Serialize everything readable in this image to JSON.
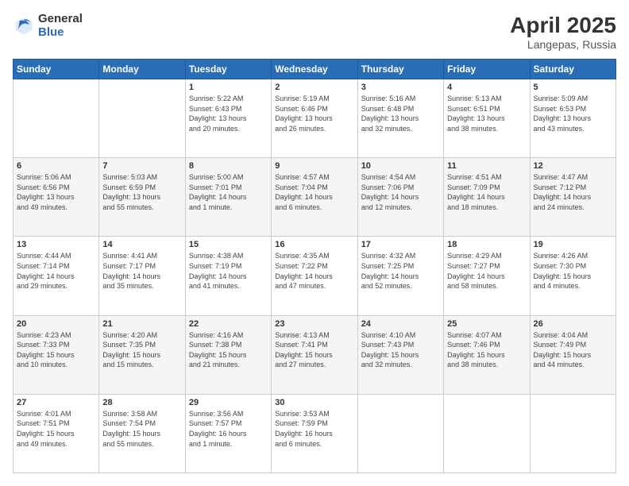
{
  "header": {
    "logo_general": "General",
    "logo_blue": "Blue",
    "title": "April 2025",
    "location": "Langepas, Russia"
  },
  "weekdays": [
    "Sunday",
    "Monday",
    "Tuesday",
    "Wednesday",
    "Thursday",
    "Friday",
    "Saturday"
  ],
  "weeks": [
    [
      {
        "day": "",
        "info": ""
      },
      {
        "day": "",
        "info": ""
      },
      {
        "day": "1",
        "info": "Sunrise: 5:22 AM\nSunset: 6:43 PM\nDaylight: 13 hours\nand 20 minutes."
      },
      {
        "day": "2",
        "info": "Sunrise: 5:19 AM\nSunset: 6:46 PM\nDaylight: 13 hours\nand 26 minutes."
      },
      {
        "day": "3",
        "info": "Sunrise: 5:16 AM\nSunset: 6:48 PM\nDaylight: 13 hours\nand 32 minutes."
      },
      {
        "day": "4",
        "info": "Sunrise: 5:13 AM\nSunset: 6:51 PM\nDaylight: 13 hours\nand 38 minutes."
      },
      {
        "day": "5",
        "info": "Sunrise: 5:09 AM\nSunset: 6:53 PM\nDaylight: 13 hours\nand 43 minutes."
      }
    ],
    [
      {
        "day": "6",
        "info": "Sunrise: 5:06 AM\nSunset: 6:56 PM\nDaylight: 13 hours\nand 49 minutes."
      },
      {
        "day": "7",
        "info": "Sunrise: 5:03 AM\nSunset: 6:59 PM\nDaylight: 13 hours\nand 55 minutes."
      },
      {
        "day": "8",
        "info": "Sunrise: 5:00 AM\nSunset: 7:01 PM\nDaylight: 14 hours\nand 1 minute."
      },
      {
        "day": "9",
        "info": "Sunrise: 4:57 AM\nSunset: 7:04 PM\nDaylight: 14 hours\nand 6 minutes."
      },
      {
        "day": "10",
        "info": "Sunrise: 4:54 AM\nSunset: 7:06 PM\nDaylight: 14 hours\nand 12 minutes."
      },
      {
        "day": "11",
        "info": "Sunrise: 4:51 AM\nSunset: 7:09 PM\nDaylight: 14 hours\nand 18 minutes."
      },
      {
        "day": "12",
        "info": "Sunrise: 4:47 AM\nSunset: 7:12 PM\nDaylight: 14 hours\nand 24 minutes."
      }
    ],
    [
      {
        "day": "13",
        "info": "Sunrise: 4:44 AM\nSunset: 7:14 PM\nDaylight: 14 hours\nand 29 minutes."
      },
      {
        "day": "14",
        "info": "Sunrise: 4:41 AM\nSunset: 7:17 PM\nDaylight: 14 hours\nand 35 minutes."
      },
      {
        "day": "15",
        "info": "Sunrise: 4:38 AM\nSunset: 7:19 PM\nDaylight: 14 hours\nand 41 minutes."
      },
      {
        "day": "16",
        "info": "Sunrise: 4:35 AM\nSunset: 7:22 PM\nDaylight: 14 hours\nand 47 minutes."
      },
      {
        "day": "17",
        "info": "Sunrise: 4:32 AM\nSunset: 7:25 PM\nDaylight: 14 hours\nand 52 minutes."
      },
      {
        "day": "18",
        "info": "Sunrise: 4:29 AM\nSunset: 7:27 PM\nDaylight: 14 hours\nand 58 minutes."
      },
      {
        "day": "19",
        "info": "Sunrise: 4:26 AM\nSunset: 7:30 PM\nDaylight: 15 hours\nand 4 minutes."
      }
    ],
    [
      {
        "day": "20",
        "info": "Sunrise: 4:23 AM\nSunset: 7:33 PM\nDaylight: 15 hours\nand 10 minutes."
      },
      {
        "day": "21",
        "info": "Sunrise: 4:20 AM\nSunset: 7:35 PM\nDaylight: 15 hours\nand 15 minutes."
      },
      {
        "day": "22",
        "info": "Sunrise: 4:16 AM\nSunset: 7:38 PM\nDaylight: 15 hours\nand 21 minutes."
      },
      {
        "day": "23",
        "info": "Sunrise: 4:13 AM\nSunset: 7:41 PM\nDaylight: 15 hours\nand 27 minutes."
      },
      {
        "day": "24",
        "info": "Sunrise: 4:10 AM\nSunset: 7:43 PM\nDaylight: 15 hours\nand 32 minutes."
      },
      {
        "day": "25",
        "info": "Sunrise: 4:07 AM\nSunset: 7:46 PM\nDaylight: 15 hours\nand 38 minutes."
      },
      {
        "day": "26",
        "info": "Sunrise: 4:04 AM\nSunset: 7:49 PM\nDaylight: 15 hours\nand 44 minutes."
      }
    ],
    [
      {
        "day": "27",
        "info": "Sunrise: 4:01 AM\nSunset: 7:51 PM\nDaylight: 15 hours\nand 49 minutes."
      },
      {
        "day": "28",
        "info": "Sunrise: 3:58 AM\nSunset: 7:54 PM\nDaylight: 15 hours\nand 55 minutes."
      },
      {
        "day": "29",
        "info": "Sunrise: 3:56 AM\nSunset: 7:57 PM\nDaylight: 16 hours\nand 1 minute."
      },
      {
        "day": "30",
        "info": "Sunrise: 3:53 AM\nSunset: 7:59 PM\nDaylight: 16 hours\nand 6 minutes."
      },
      {
        "day": "",
        "info": ""
      },
      {
        "day": "",
        "info": ""
      },
      {
        "day": "",
        "info": ""
      }
    ]
  ]
}
